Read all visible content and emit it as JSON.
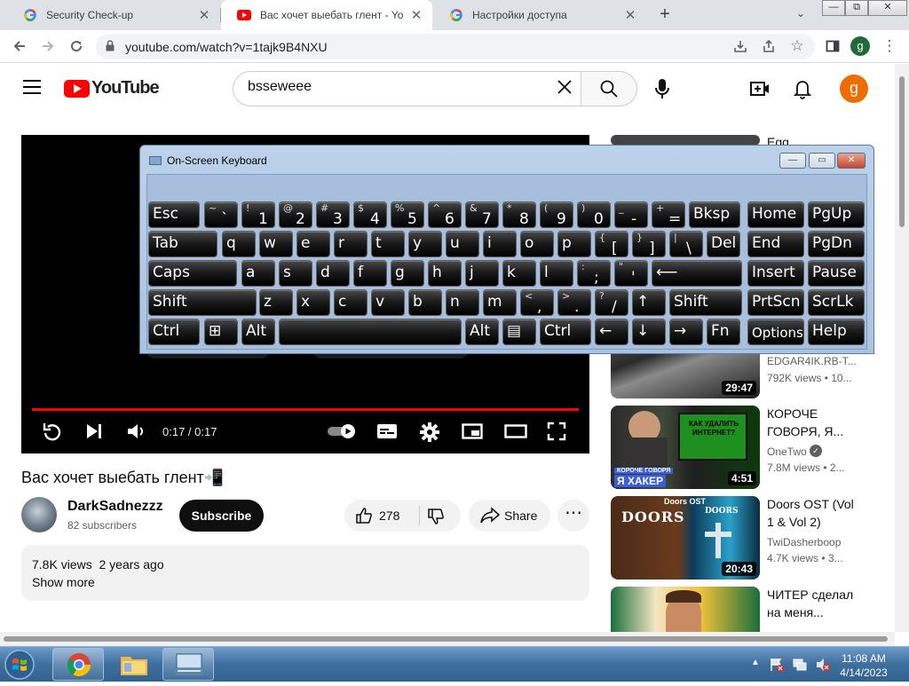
{
  "browser": {
    "tabs": [
      {
        "title": "Security Check-up",
        "active": false
      },
      {
        "title": "Вас хочет выебать глент⁠ - You",
        "active": true
      },
      {
        "title": "Настройки доступа",
        "active": false
      }
    ],
    "new_tab": "+",
    "url": "youtube.com/watch?v=1tajk9B4NXU",
    "profile_letter": "g"
  },
  "youtube": {
    "logo_text": "YouTube",
    "search_value": "bsseweee",
    "avatar_letter": "g",
    "player": {
      "time": "0:17 / 0:17",
      "progress": 1.0
    },
    "video": {
      "title": "Вас хочет выебать глент📲",
      "channel": "DarkSadnezzz",
      "subscribers": "82 subscribers",
      "subscribe_label": "Subscribe",
      "likes": "278",
      "share_label": "Share",
      "views_date": "7.8K views  2 years ago",
      "show_more": "Show more"
    },
    "recommendations": [
      {
        "title": "Egg",
        "channel": "",
        "views": "",
        "duration": ""
      },
      {
        "title": "",
        "channel": "EDGAR4IK.RB-T...",
        "views": "792K views  •  10...",
        "duration": "29:47"
      },
      {
        "title": "КОРОЧЕ ГОВОРЯ, Я...",
        "channel": "OneTwo",
        "views": "7.8M views  •  2...",
        "duration": "4:51",
        "thumb_text_top": "КАК УДАЛИТЬ ИНТЕРНЕТ?",
        "thumb_text_small": "КОРОЧЕ ГОВОРЯ",
        "thumb_text_big": "Я ХАКЕР"
      },
      {
        "title": "Doors OST (Vol 1 & Vol 2)",
        "channel": "TwiDasherboop",
        "views": "4.7K views  •  3...",
        "duration": "20:43",
        "thumb_text": "Doors OST",
        "thumb_logo": "DOORS"
      },
      {
        "title": "ЧИТЕР сделал на меня...",
        "channel": "",
        "views": "",
        "duration": ""
      }
    ]
  },
  "osk": {
    "title": "On-Screen Keyboard",
    "rows": [
      [
        {
          "main": "Esc"
        },
        {
          "hi": "~",
          "lo": "`"
        },
        {
          "hi": "!",
          "lo": "1"
        },
        {
          "hi": "@",
          "lo": "2"
        },
        {
          "hi": "#",
          "lo": "3"
        },
        {
          "hi": "$",
          "lo": "4"
        },
        {
          "hi": "%",
          "lo": "5"
        },
        {
          "hi": "^",
          "lo": "6"
        },
        {
          "hi": "&",
          "lo": "7"
        },
        {
          "hi": "*",
          "lo": "8"
        },
        {
          "hi": "(",
          "lo": "9"
        },
        {
          "hi": ")",
          "lo": "0"
        },
        {
          "hi": "_",
          "lo": "-"
        },
        {
          "hi": "+",
          "lo": "="
        },
        {
          "main": "Bksp"
        },
        {
          "main": "Home"
        },
        {
          "main": "PgUp"
        }
      ],
      [
        {
          "main": "Tab"
        },
        {
          "main": "q"
        },
        {
          "main": "w"
        },
        {
          "main": "e"
        },
        {
          "main": "r"
        },
        {
          "main": "t"
        },
        {
          "main": "y"
        },
        {
          "main": "u"
        },
        {
          "main": "i"
        },
        {
          "main": "o"
        },
        {
          "main": "p"
        },
        {
          "hi": "{",
          "lo": "["
        },
        {
          "hi": "}",
          "lo": "]"
        },
        {
          "hi": "|",
          "lo": "\\"
        },
        {
          "main": "Del"
        },
        {
          "main": "End"
        },
        {
          "main": "PgDn"
        }
      ],
      [
        {
          "main": "Caps"
        },
        {
          "main": "a"
        },
        {
          "main": "s"
        },
        {
          "main": "d"
        },
        {
          "main": "f"
        },
        {
          "main": "g"
        },
        {
          "main": "h"
        },
        {
          "main": "j"
        },
        {
          "main": "k"
        },
        {
          "main": "l"
        },
        {
          "hi": ":",
          "lo": ";"
        },
        {
          "hi": "\"",
          "lo": "'"
        },
        {
          "main": "⟵"
        },
        {
          "main": "Insert"
        },
        {
          "main": "Pause"
        }
      ],
      [
        {
          "main": "Shift"
        },
        {
          "main": "z"
        },
        {
          "main": "x"
        },
        {
          "main": "c"
        },
        {
          "main": "v"
        },
        {
          "main": "b"
        },
        {
          "main": "n"
        },
        {
          "main": "m"
        },
        {
          "hi": "<",
          "lo": ","
        },
        {
          "hi": ">",
          "lo": "."
        },
        {
          "hi": "?",
          "lo": "/"
        },
        {
          "main": "↑"
        },
        {
          "main": "Shift"
        },
        {
          "main": "PrtScn"
        },
        {
          "main": "ScrLk"
        }
      ],
      [
        {
          "main": "Ctrl"
        },
        {
          "main": "⊞"
        },
        {
          "main": "Alt"
        },
        {
          "main": ""
        },
        {
          "main": "Alt"
        },
        {
          "main": "▤"
        },
        {
          "main": "Ctrl"
        },
        {
          "main": "←"
        },
        {
          "main": "↓"
        },
        {
          "main": "→"
        },
        {
          "main": "Fn"
        },
        {
          "main": "Options"
        },
        {
          "main": "Help"
        }
      ]
    ]
  },
  "taskbar": {
    "time": "11:08 AM",
    "date": "4/14/2023"
  },
  "colors": {
    "youtube_red": "#ff0000",
    "osk_frame": "#a9c3e0",
    "taskbar": "#3e6f9e"
  }
}
